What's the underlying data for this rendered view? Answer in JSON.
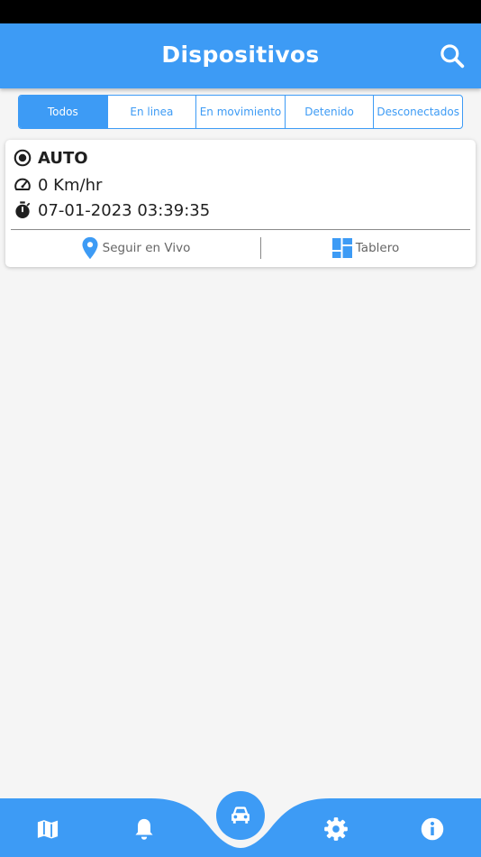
{
  "header": {
    "title": "Dispositivos"
  },
  "icons": {
    "search": "search-icon",
    "status": "radio-button-icon",
    "speed": "speedometer-icon",
    "time": "stopwatch-icon",
    "location": "location-pin-icon",
    "dashboard": "dashboard-icon",
    "nav_map": "map-icon",
    "nav_alerts": "bell-icon",
    "nav_devices": "car-icon",
    "nav_settings": "gear-icon",
    "nav_info": "info-icon"
  },
  "filters": [
    {
      "label": "Todos",
      "active": true
    },
    {
      "label": "En linea",
      "active": false
    },
    {
      "label": "En movimiento",
      "active": false
    },
    {
      "label": "Detenido",
      "active": false
    },
    {
      "label": "Desconectados",
      "active": false
    }
  ],
  "device": {
    "name": "AUTO",
    "speed": "0 Km/hr",
    "timestamp": "07-01-2023 03:39:35",
    "follow_label": "Seguir en Vivo",
    "dashboard_label": "Tablero"
  },
  "colors": {
    "primary": "#3d9bf5",
    "background": "#f5f5f5",
    "text": "#1f1f1f"
  }
}
